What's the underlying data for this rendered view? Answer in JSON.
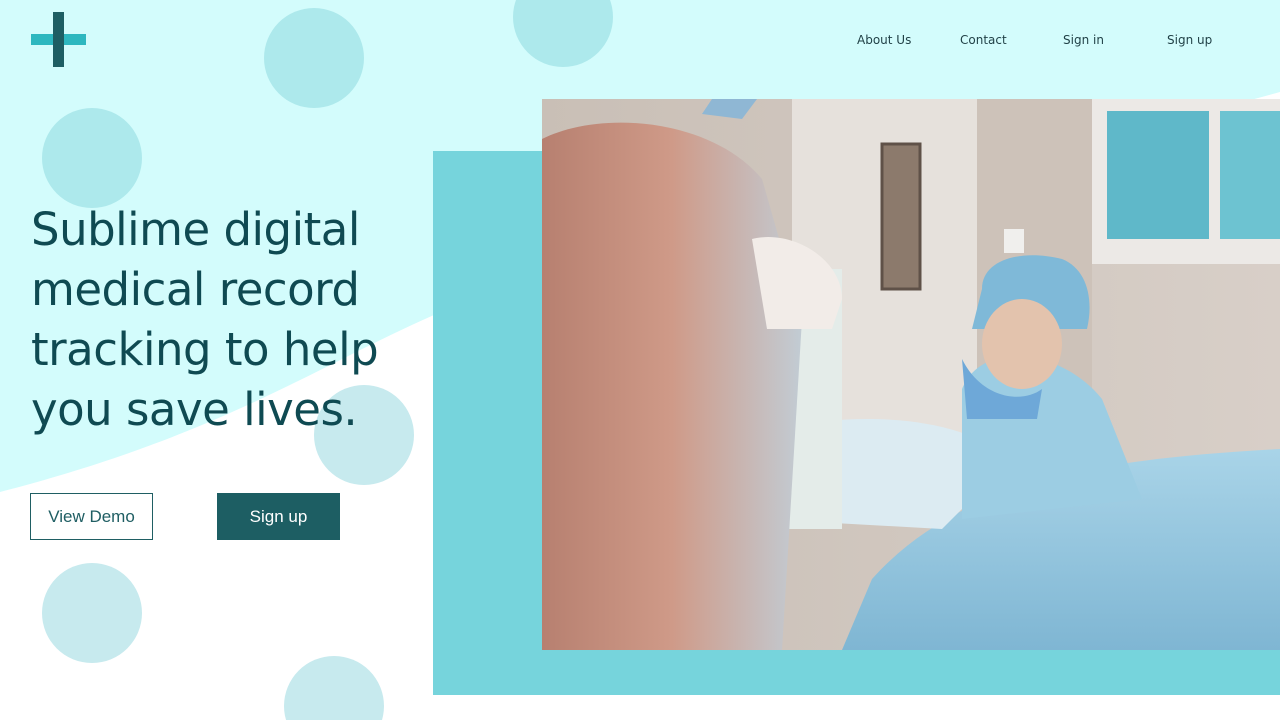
{
  "nav": {
    "about": "About Us",
    "contact": "Contact",
    "sign_in": "Sign in",
    "sign_up": "Sign up"
  },
  "hero": {
    "title": "Sublime digital medical record tracking to help you save lives."
  },
  "buttons": {
    "view_demo": "View Demo",
    "sign_up": "Sign up"
  },
  "colors": {
    "background_light": "#d3fcfc",
    "accent": "#76d4dc",
    "primary": "#1d5e63",
    "logo_light": "#2db7bf",
    "heading": "#0f4a52"
  },
  "icons": {
    "logo": "medical-cross-icon"
  }
}
